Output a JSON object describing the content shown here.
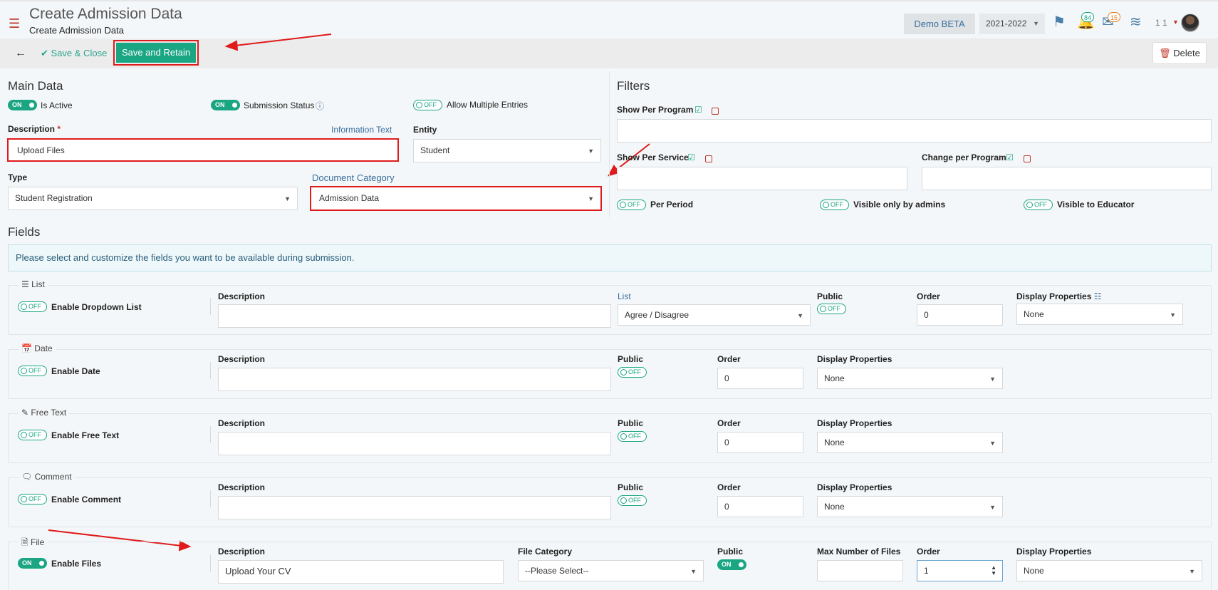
{
  "header": {
    "title": "Create Admission Data",
    "subtitle": "Create Admission Data",
    "env_badge": "Demo BETA",
    "year": "2021-2022",
    "notifications_count": "84",
    "messages_count": "15",
    "user_label": "1 1"
  },
  "toolbar": {
    "save_close_label": "Save & Close",
    "save_retain_label": "Save and Retain",
    "delete_label": "Delete"
  },
  "main_data": {
    "title": "Main Data",
    "toggles": [
      {
        "state": "ON",
        "label": "Is Active"
      },
      {
        "state": "ON",
        "label": "Submission Status"
      },
      {
        "state": "OFF",
        "label": "Allow Multiple Entries"
      }
    ],
    "description_label": "Description",
    "description_required": "*",
    "information_text_label": "Information Text",
    "description_value": "Upload Files",
    "entity_label": "Entity",
    "entity_value": "Student",
    "type_label": "Type",
    "type_value": "Student Registration",
    "doc_category_label": "Document Category",
    "doc_category_value": "Admission Data"
  },
  "filters": {
    "title": "Filters",
    "show_per_program": "Show Per Program",
    "show_per_service": "Show Per Service",
    "change_per_program": "Change per Program",
    "toggles": [
      {
        "state": "OFF",
        "label": "Per Period"
      },
      {
        "state": "OFF",
        "label": "Visible only by admins"
      },
      {
        "state": "OFF",
        "label": "Visible to Educator"
      }
    ]
  },
  "fields": {
    "title": "Fields",
    "info": "Please select and customize the fields you want to be available during submission.",
    "labels": {
      "description": "Description",
      "public": "Public",
      "order": "Order",
      "display_properties": "Display Properties",
      "list": "List",
      "file_category": "File Category",
      "max_files": "Max Number of Files"
    },
    "groups": [
      {
        "legend": "List",
        "toggle": "OFF",
        "enable_label": "Enable Dropdown List",
        "list_value": "Agree / Disagree",
        "public": "OFF",
        "order": "0",
        "display": "None"
      },
      {
        "legend": "Date",
        "toggle": "OFF",
        "enable_label": "Enable Date",
        "public": "OFF",
        "order": "0",
        "display": "None"
      },
      {
        "legend": "Free Text",
        "toggle": "OFF",
        "enable_label": "Enable Free Text",
        "public": "OFF",
        "order": "0",
        "display": "None"
      },
      {
        "legend": "Comment",
        "toggle": "OFF",
        "enable_label": "Enable Comment",
        "public": "OFF",
        "order": "0",
        "display": "None"
      },
      {
        "legend": "File",
        "toggle": "ON",
        "enable_label": "Enable Files",
        "description_value": "Upload Your CV",
        "file_category_value": "--Please Select--",
        "public": "ON",
        "max_files": "",
        "order": "1",
        "display": "None"
      }
    ]
  }
}
